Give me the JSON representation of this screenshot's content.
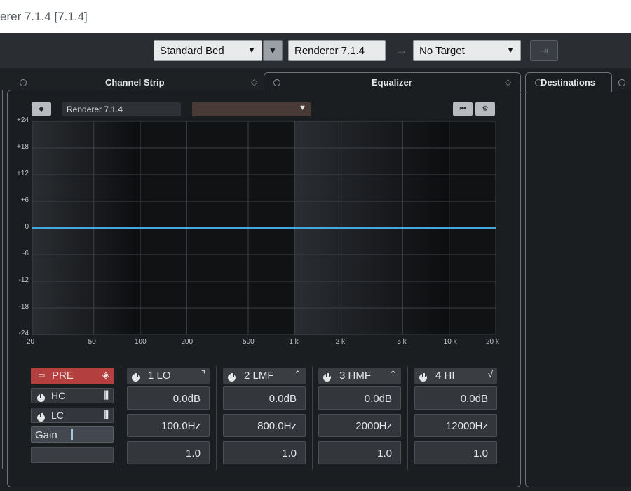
{
  "window": {
    "title": "erer 7.1.4  [7.1.4]"
  },
  "toolbar": {
    "bed_select": "Standard Bed",
    "renderer_field": "Renderer 7.1.4",
    "target_select": "No Target"
  },
  "tabs": {
    "channel_strip": "Channel Strip",
    "equalizer": "Equalizer",
    "destinations": "Destinations"
  },
  "eq": {
    "preset_name": "Renderer 7.1.4",
    "y_ticks": [
      "+24",
      "+18",
      "+12",
      "+6",
      "0",
      "-6",
      "-12",
      "-18",
      "-24"
    ],
    "x_ticks": [
      "20",
      "50",
      "100",
      "200",
      "500",
      "1 k",
      "2 k",
      "5 k",
      "10 k",
      "20 k"
    ],
    "curve_color": "#3fa9e0",
    "pre_label": "PRE",
    "hc_label": "HC",
    "lc_label": "LC",
    "gain_label": "Gain",
    "bands": [
      {
        "label": "1 LO",
        "gain": "0.0dB",
        "freq": "100.0Hz",
        "q": "1.0"
      },
      {
        "label": "2 LMF",
        "gain": "0.0dB",
        "freq": "800.0Hz",
        "q": "1.0"
      },
      {
        "label": "3 HMF",
        "gain": "0.0dB",
        "freq": "2000Hz",
        "q": "1.0"
      },
      {
        "label": "4 HI",
        "gain": "0.0dB",
        "freq": "12000Hz",
        "q": "1.0"
      }
    ]
  }
}
